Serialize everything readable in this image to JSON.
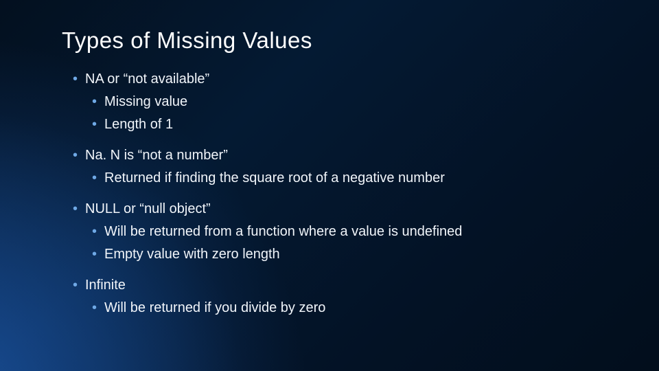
{
  "slide": {
    "title": "Types of Missing Values",
    "bullets": [
      {
        "text": "NA or “not available”",
        "children": [
          {
            "text": "Missing value"
          },
          {
            "text": "Length of 1"
          }
        ]
      },
      {
        "text": "Na. N is “not a number”",
        "children": [
          {
            "text": "Returned if finding the square root of a negative number"
          }
        ]
      },
      {
        "text": "NULL or “null object”",
        "children": [
          {
            "text": "Will be returned from a function where a value is undefined"
          },
          {
            "text": "Empty value with zero length"
          }
        ]
      },
      {
        "text": "Infinite",
        "children": [
          {
            "text": "Will be returned if you divide by zero"
          }
        ]
      }
    ]
  }
}
